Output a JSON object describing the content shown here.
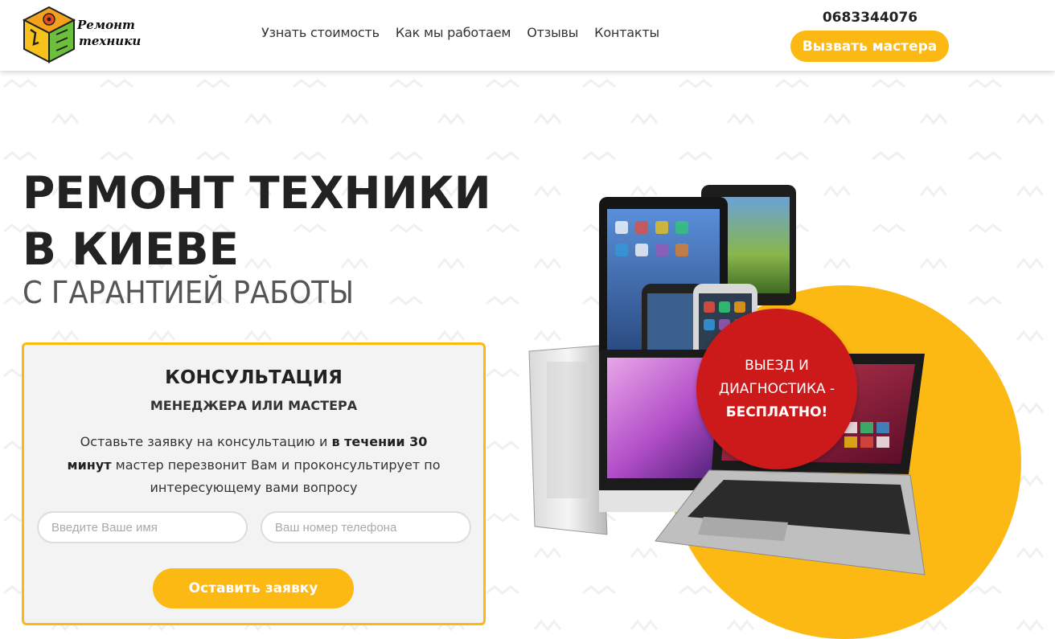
{
  "logo": {
    "line1": "Ремонт",
    "line2": "техники"
  },
  "nav": {
    "items": [
      "Узнать стоимость",
      "Как мы работаем",
      "Отзывы",
      "Контакты"
    ]
  },
  "header": {
    "phone": "0683344076",
    "call_button": "Вызвать мастера"
  },
  "hero": {
    "title_line1": "РЕМОНТ ТЕХНИКИ",
    "title_line2": "В КИЕВЕ",
    "subtitle": "С ГАРАНТИЕЙ РАБОТЫ"
  },
  "form": {
    "title": "КОНСУЛЬТАЦИЯ",
    "subtitle": "МЕНЕДЖЕРА ИЛИ МАСТЕРА",
    "text_part1": "Оставьте заявку на консультацию и ",
    "text_bold": "в течении 30 минут",
    "text_part2": " мастер перезвонит Вам и проконсультирует по интересующему вами вопросу",
    "name_placeholder": "Введите Ваше имя",
    "phone_placeholder": "Ваш номер телефона",
    "submit_label": "Оставить заявку"
  },
  "badge": {
    "line1": "ВЫЕЗД И",
    "line2": "ДИАГНОСТИКА -",
    "line3": "БЕСПЛАТНО!"
  },
  "colors": {
    "accent": "#fdb913",
    "badge": "#cc1a1a",
    "text": "#222222"
  }
}
